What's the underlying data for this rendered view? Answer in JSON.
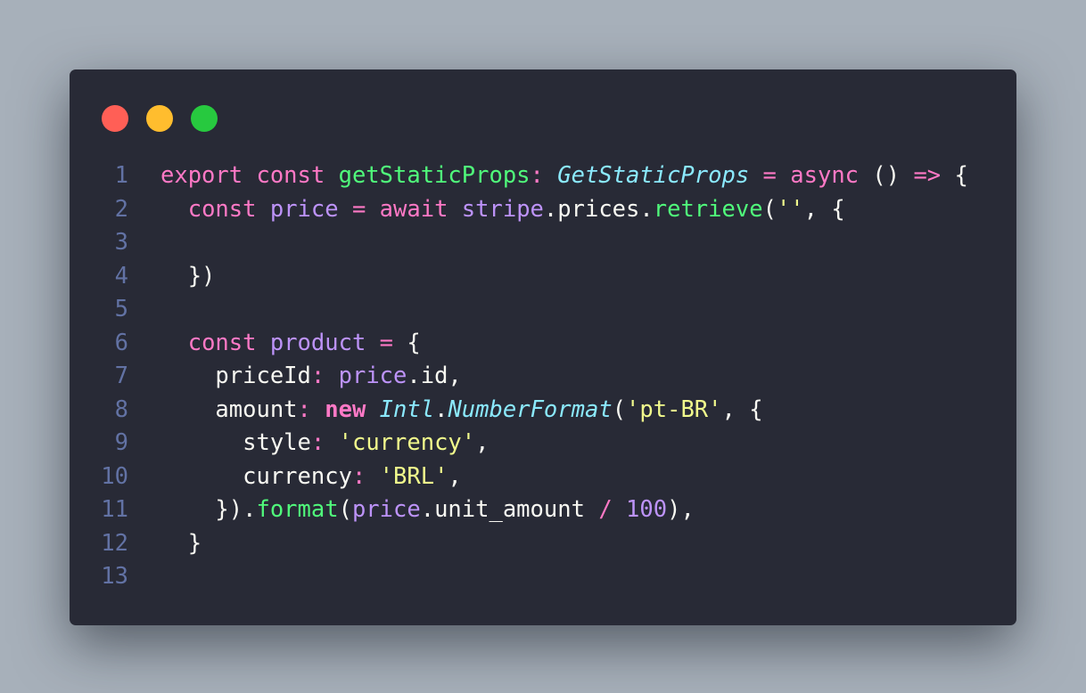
{
  "window": {
    "controls": {
      "close_color": "#ff5f56",
      "minimize_color": "#ffbd2e",
      "maximize_color": "#27c93f"
    }
  },
  "editor": {
    "lines": [
      {
        "number": "1",
        "tokens": [
          {
            "t": "export ",
            "k": "keyword"
          },
          {
            "t": "const ",
            "k": "keyword"
          },
          {
            "t": "getStaticProps",
            "k": "func"
          },
          {
            "t": ": ",
            "k": "keyword"
          },
          {
            "t": "GetStaticProps",
            "k": "type"
          },
          {
            "t": " ",
            "k": "plain"
          },
          {
            "t": "=",
            "k": "keyword"
          },
          {
            "t": " async ",
            "k": "keyword"
          },
          {
            "t": "() ",
            "k": "plain"
          },
          {
            "t": "=>",
            "k": "keyword"
          },
          {
            "t": " {",
            "k": "plain"
          }
        ]
      },
      {
        "number": "2",
        "tokens": [
          {
            "t": "  ",
            "k": "plain"
          },
          {
            "t": "const ",
            "k": "keyword"
          },
          {
            "t": "price",
            "k": "var"
          },
          {
            "t": " = ",
            "k": "keyword"
          },
          {
            "t": "await ",
            "k": "keyword"
          },
          {
            "t": "stripe",
            "k": "var"
          },
          {
            "t": ".prices.",
            "k": "plain"
          },
          {
            "t": "retrieve",
            "k": "func"
          },
          {
            "t": "(",
            "k": "plain"
          },
          {
            "t": "''",
            "k": "string"
          },
          {
            "t": ", {",
            "k": "plain"
          }
        ]
      },
      {
        "number": "3",
        "tokens": []
      },
      {
        "number": "4",
        "tokens": [
          {
            "t": "  })",
            "k": "plain"
          }
        ]
      },
      {
        "number": "5",
        "tokens": []
      },
      {
        "number": "6",
        "tokens": [
          {
            "t": "  ",
            "k": "plain"
          },
          {
            "t": "const ",
            "k": "keyword"
          },
          {
            "t": "product",
            "k": "var"
          },
          {
            "t": " = ",
            "k": "keyword"
          },
          {
            "t": "{",
            "k": "plain"
          }
        ]
      },
      {
        "number": "7",
        "tokens": [
          {
            "t": "    priceId",
            "k": "plain"
          },
          {
            "t": ": ",
            "k": "keyword"
          },
          {
            "t": "price",
            "k": "var"
          },
          {
            "t": ".id,",
            "k": "plain"
          }
        ]
      },
      {
        "number": "8",
        "tokens": [
          {
            "t": "    amount",
            "k": "plain"
          },
          {
            "t": ": ",
            "k": "keyword"
          },
          {
            "t": "new ",
            "k": "bold"
          },
          {
            "t": "Intl",
            "k": "type"
          },
          {
            "t": ".",
            "k": "plain"
          },
          {
            "t": "NumberFormat",
            "k": "type"
          },
          {
            "t": "(",
            "k": "plain"
          },
          {
            "t": "'pt-BR'",
            "k": "string"
          },
          {
            "t": ", {",
            "k": "plain"
          }
        ]
      },
      {
        "number": "9",
        "tokens": [
          {
            "t": "      style",
            "k": "plain"
          },
          {
            "t": ": ",
            "k": "keyword"
          },
          {
            "t": "'currency'",
            "k": "string"
          },
          {
            "t": ",",
            "k": "plain"
          }
        ]
      },
      {
        "number": "10",
        "tokens": [
          {
            "t": "      currency",
            "k": "plain"
          },
          {
            "t": ": ",
            "k": "keyword"
          },
          {
            "t": "'BRL'",
            "k": "string"
          },
          {
            "t": ",",
            "k": "plain"
          }
        ]
      },
      {
        "number": "11",
        "tokens": [
          {
            "t": "    }).",
            "k": "plain"
          },
          {
            "t": "format",
            "k": "func"
          },
          {
            "t": "(",
            "k": "plain"
          },
          {
            "t": "price",
            "k": "var"
          },
          {
            "t": ".unit_amount ",
            "k": "plain"
          },
          {
            "t": "/",
            "k": "keyword"
          },
          {
            "t": " ",
            "k": "plain"
          },
          {
            "t": "100",
            "k": "number"
          },
          {
            "t": "),",
            "k": "plain"
          }
        ]
      },
      {
        "number": "12",
        "tokens": [
          {
            "t": "  }",
            "k": "plain"
          }
        ]
      },
      {
        "number": "13",
        "tokens": []
      }
    ]
  }
}
